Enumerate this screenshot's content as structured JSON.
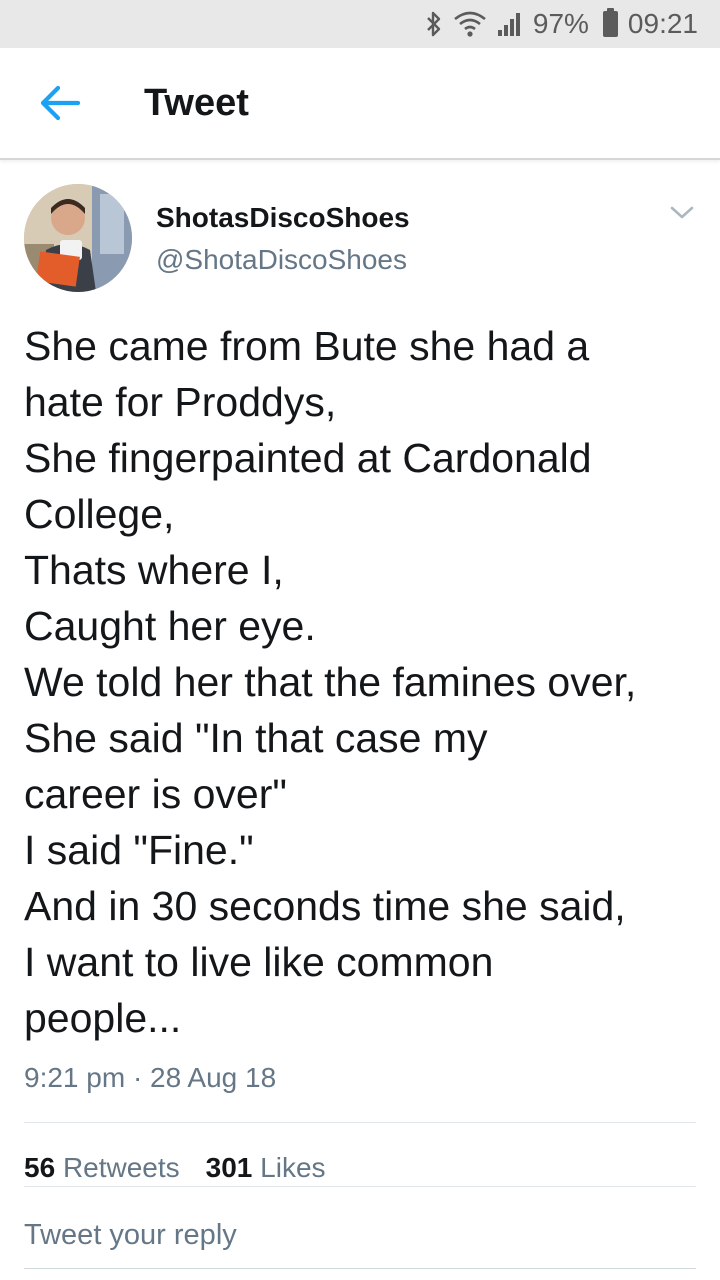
{
  "status_bar": {
    "battery": "97%",
    "time": "09:21",
    "icons": [
      "bluetooth-icon",
      "wifi-icon",
      "signal-icon",
      "battery-icon"
    ]
  },
  "app_bar": {
    "back_icon": "arrow-left-icon",
    "title": "Tweet"
  },
  "tweet": {
    "display_name": "ShotasDiscoShoes",
    "handle": "@ShotaDiscoShoes",
    "text_lines": [
      "She came from Bute she had a",
      "hate for Proddys,",
      "She fingerpainted at Cardonald",
      "College,",
      "Thats where I,",
      "Caught her eye.",
      "We told her that the famines over,",
      "She said \"In that case my",
      "career is over\"",
      "I said \"Fine.\"",
      "And in 30 seconds time she said,",
      "I want to live like common",
      "people..."
    ],
    "timestamp": "9:21 pm · 28 Aug 18",
    "retweets_count": "56",
    "retweets_label": "Retweets",
    "likes_count": "301",
    "likes_label": "Likes"
  },
  "reply": {
    "placeholder": "Tweet your reply"
  },
  "colors": {
    "accent": "#1da1f2",
    "secondary_text": "#657786",
    "primary_text": "#14171a",
    "status_bar_bg": "#e8e8e8"
  }
}
